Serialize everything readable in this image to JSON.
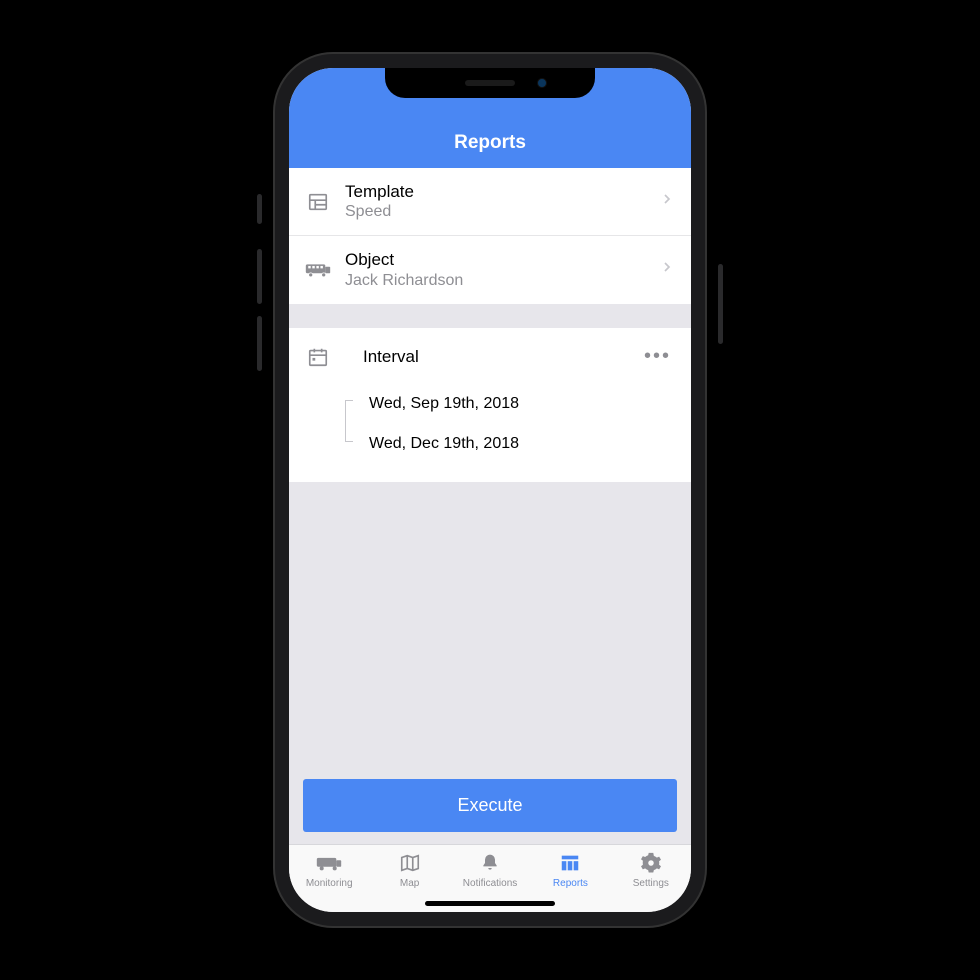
{
  "header": {
    "title": "Reports"
  },
  "rows": {
    "template": {
      "title": "Template",
      "sub": "Speed"
    },
    "object": {
      "title": "Object",
      "sub": "Jack Richardson"
    }
  },
  "interval": {
    "title": "Interval",
    "start": "Wed, Sep 19th, 2018",
    "end": "Wed, Dec 19th, 2018"
  },
  "buttons": {
    "execute": "Execute"
  },
  "tabs": {
    "monitoring": "Monitoring",
    "map": "Map",
    "notifications": "Notifications",
    "reports": "Reports",
    "settings": "Settings"
  }
}
